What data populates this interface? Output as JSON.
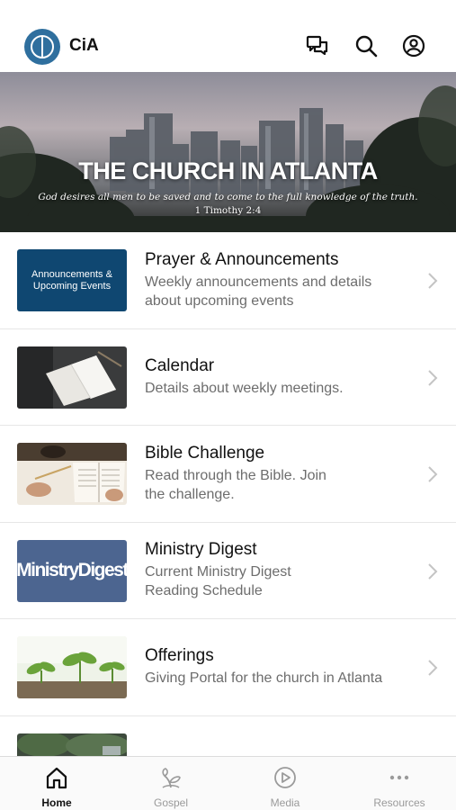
{
  "header": {
    "app_name": "CiA",
    "icons": [
      "chat-icon",
      "search-icon",
      "account-icon"
    ]
  },
  "hero": {
    "title": "THE CHURCH IN ATLANTA",
    "verse": "God desires all men to be saved and to come to the full knowledge of the truth.",
    "reference": "1 Timothy 2:4"
  },
  "items": [
    {
      "title": "Prayer & Announcements",
      "line1": "Weekly announcements and details",
      "line2": "about upcoming events",
      "thumb_text": "Announcements & Upcoming Events"
    },
    {
      "title": "Calendar",
      "line1": "Details about weekly meetings.",
      "line2": ""
    },
    {
      "title": "Bible Challenge",
      "line1": "Read through the Bible. Join",
      "line2": "the challenge."
    },
    {
      "title": "Ministry Digest",
      "line1": "Current Ministry Digest",
      "line2": "Reading Schedule",
      "thumb_text": "MinistryDigest"
    },
    {
      "title": "Offerings",
      "line1": "Giving Portal for the church in Atlanta",
      "line2": ""
    }
  ],
  "tabs": [
    {
      "label": "Home",
      "active": true
    },
    {
      "label": "Gospel",
      "active": false
    },
    {
      "label": "Media",
      "active": false
    },
    {
      "label": "Resources",
      "active": false
    }
  ],
  "colors": {
    "logo_blue": "#2f6f9e",
    "announcements_blue": "#0f4771",
    "ministry_digest_blue": "#4c6590",
    "subtitle_gray": "#6d6d6d",
    "tab_inactive": "#9a9a9a"
  }
}
